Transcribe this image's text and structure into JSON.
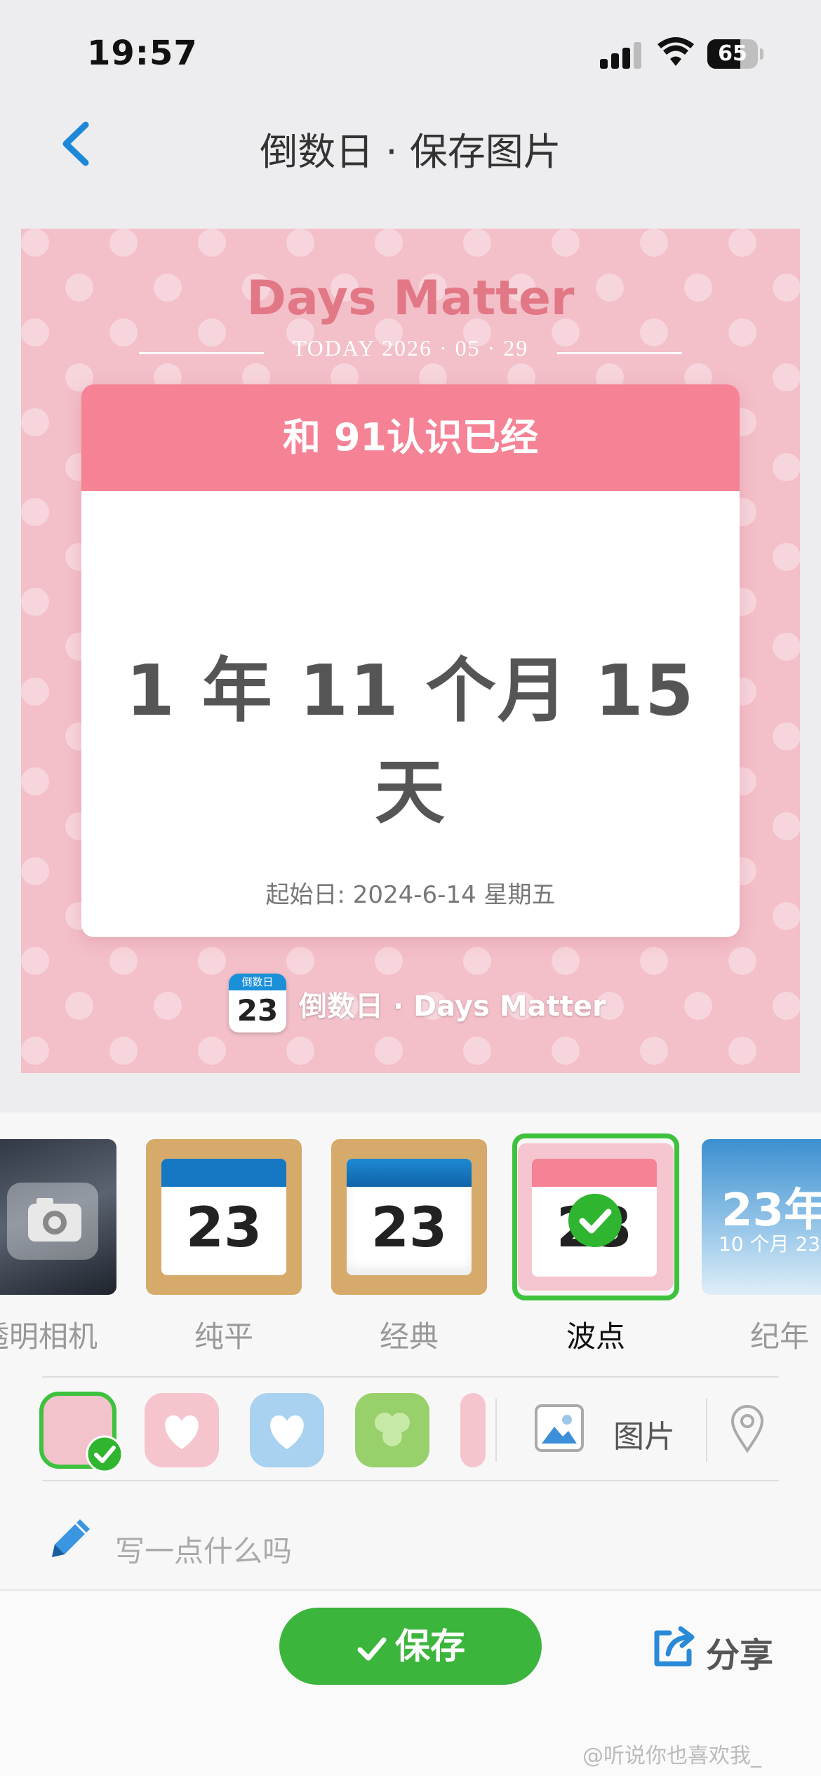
{
  "status_bar": {
    "time": "19:57",
    "battery": "65",
    "battery_level": 0.65
  },
  "nav": {
    "title": "倒数日 · 保存图片"
  },
  "card": {
    "brand": "Days Matter",
    "today_label": "TODAY 2026 · 05 · 29",
    "event_title": "和 91认识已经",
    "count_text": "1 年 11 个月 15 天",
    "start_date": "起始日: 2024-6-14 星期五",
    "footer_icon_top": "倒数日",
    "footer_icon_num": "23",
    "footer_text": "倒数日 · Days Matter",
    "colors": {
      "background": "#f3bfc9",
      "header": "#f58395",
      "brand": "#e27886"
    }
  },
  "themes": [
    {
      "label": "透明相机",
      "icon": "camera-icon"
    },
    {
      "label": "纯平",
      "number": "23"
    },
    {
      "label": "经典",
      "number": "23"
    },
    {
      "label": "波点",
      "number": "23",
      "selected": true
    },
    {
      "label": "纪年",
      "number": "23年",
      "sub": "10 个月 23"
    }
  ],
  "backgrounds": [
    "pink-dots",
    "pink-heart",
    "blue-heart",
    "green-clover",
    "pink-more"
  ],
  "image_button": {
    "label": "图片",
    "icon": "image-icon"
  },
  "location_icon": "location-pin-icon",
  "note": {
    "placeholder": "写一点什么吗",
    "icon": "pencil-icon"
  },
  "actions": {
    "save": "保存",
    "share": "分享"
  },
  "watermark": "@听说你也喜欢我_"
}
